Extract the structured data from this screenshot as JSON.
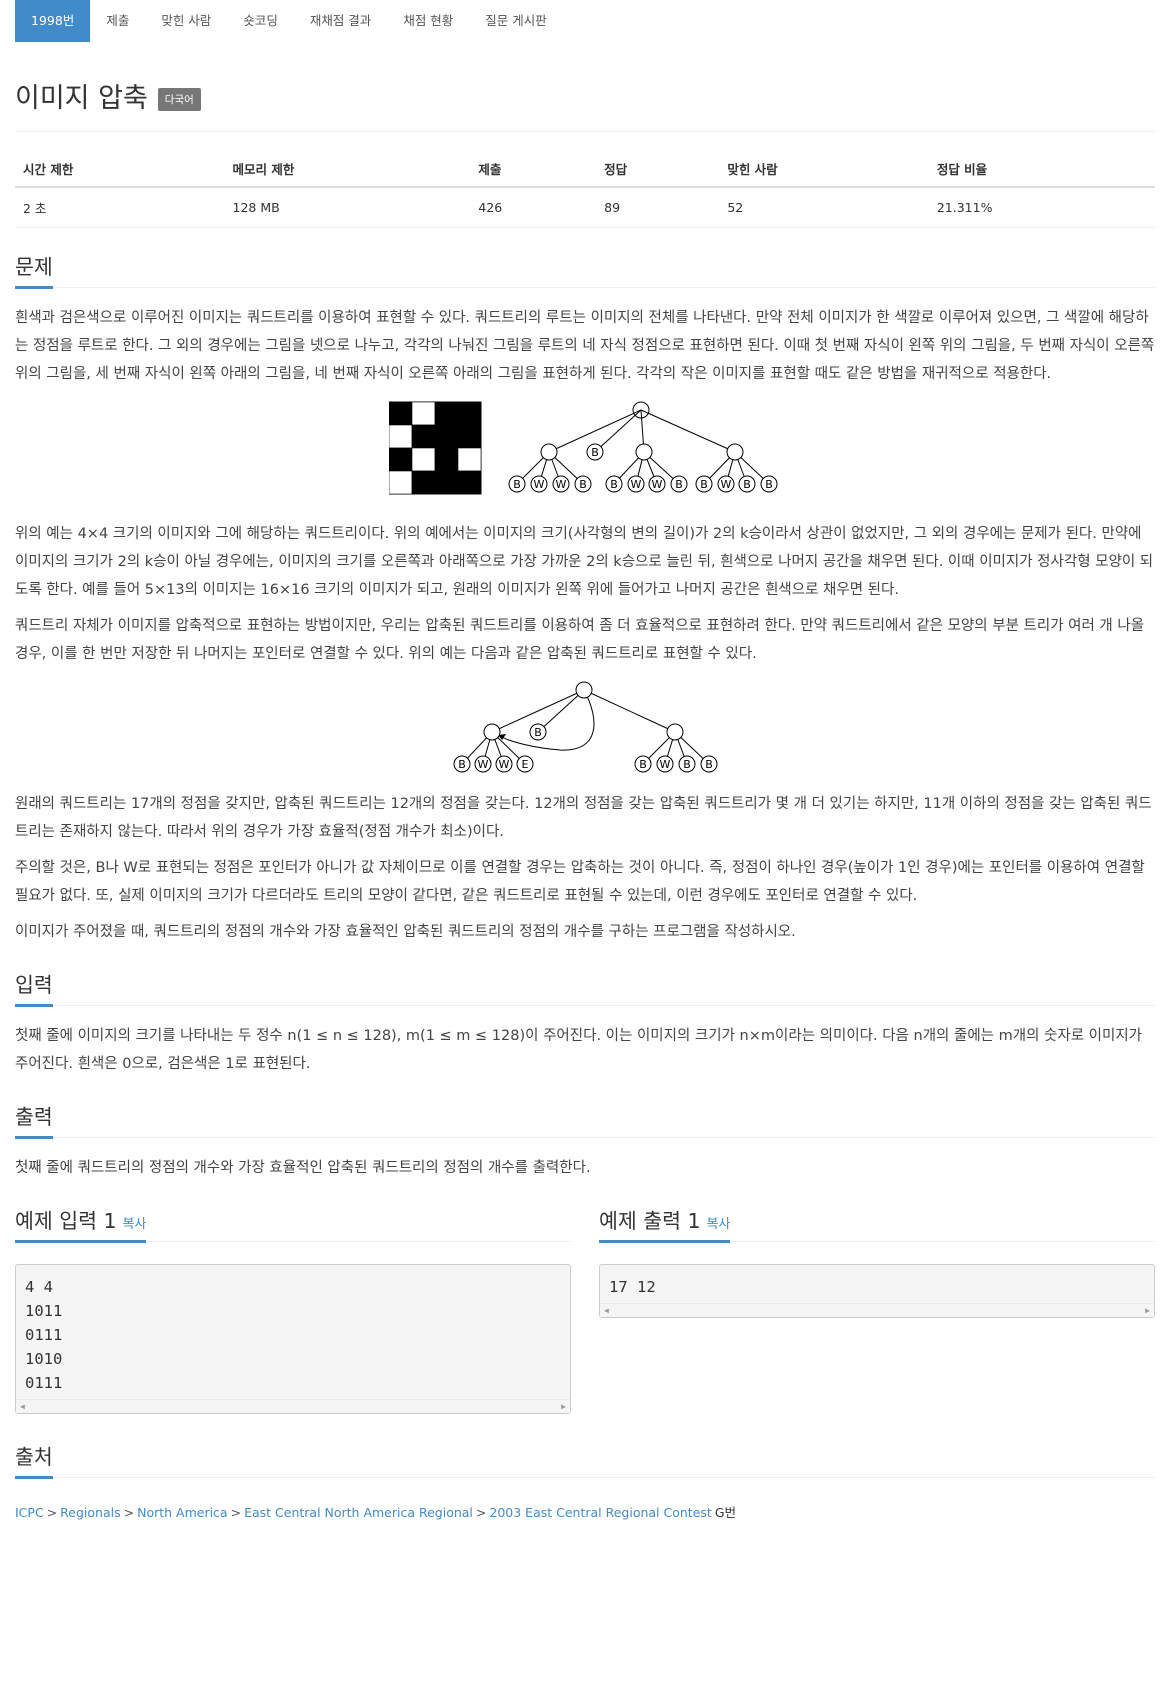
{
  "tabs": [
    {
      "label": "1998번",
      "active": true
    },
    {
      "label": "제출",
      "active": false
    },
    {
      "label": "맞힌 사람",
      "active": false
    },
    {
      "label": "숏코딩",
      "active": false
    },
    {
      "label": "재채점 결과",
      "active": false
    },
    {
      "label": "채점 현황",
      "active": false
    },
    {
      "label": "질문 게시판",
      "active": false
    }
  ],
  "problem": {
    "title": "이미지 압축",
    "badge": "다국어"
  },
  "info": {
    "headers": [
      "시간 제한",
      "메모리 제한",
      "제출",
      "정답",
      "맞힌 사람",
      "정답 비율"
    ],
    "values": [
      "2 초",
      "128 MB",
      "426",
      "89",
      "52",
      "21.311%"
    ]
  },
  "sections": {
    "problem": {
      "heading": "문제",
      "p1": "흰색과 검은색으로 이루어진 이미지는 쿼드트리를 이용하여 표현할 수 있다. 쿼드트리의 루트는 이미지의 전체를 나타낸다. 만약 전체 이미지가 한 색깔로 이루어져 있으면, 그 색깔에 해당하는 정점을 루트로 한다. 그 외의 경우에는 그림을 넷으로 나누고, 각각의 나눠진 그림을 루트의 네 자식 정점으로 표현하면 된다. 이때 첫 번째 자식이 왼쪽 위의 그림을, 두 번째 자식이 오른쪽 위의 그림을, 세 번째 자식이 왼쪽 아래의 그림을, 네 번째 자식이 오른쪽 아래의 그림을 표현하게 된다. 각각의 작은 이미지를 표현할 때도 같은 방법을 재귀적으로 적용한다.",
      "p2": "위의 예는 4×4 크기의 이미지와 그에 해당하는 쿼드트리이다. 위의 예에서는 이미지의 크기(사각형의 변의 길이)가 2의 k승이라서 상관이 없었지만, 그 외의 경우에는 문제가 된다. 만약에 이미지의 크기가 2의 k승이 아닐 경우에는, 이미지의 크기를 오른쪽과 아래쪽으로 가장 가까운 2의 k승으로 늘린 뒤, 흰색으로 나머지 공간을 채우면 된다. 이때 이미지가 정사각형 모양이 되도록 한다. 예를 들어 5×13의 이미지는 16×16 크기의 이미지가 되고, 원래의 이미지가 왼쪽 위에 들어가고 나머지 공간은 흰색으로 채우면 된다.",
      "p3": "쿼드트리 자체가 이미지를 압축적으로 표현하는 방법이지만, 우리는 압축된 쿼드트리를 이용하여 좀 더 효율적으로 표현하려 한다. 만약 쿼드트리에서 같은 모양의 부분 트리가 여러 개 나올 경우, 이를 한 번만 저장한 뒤 나머지는 포인터로 연결할 수 있다. 위의 예는 다음과 같은 압축된 쿼드트리로 표현할 수 있다.",
      "p4": "원래의 쿼드트리는 17개의 정점을 갖지만, 압축된 쿼드트리는 12개의 정점을 갖는다. 12개의 정점을 갖는 압축된 쿼드트리가 몇 개 더 있기는 하지만, 11개 이하의 정점을 갖는 압축된 쿼드트리는 존재하지 않는다. 따라서 위의 경우가 가장 효율적(정점 개수가 최소)이다.",
      "p5": "주의할 것은, B나 W로 표현되는 정점은 포인터가 아니가 값 자체이므로 이를 연결할 경우는 압축하는 것이 아니다. 즉, 정점이 하나인 경우(높이가 1인 경우)에는 포인터를 이용하여 연결할 필요가 없다. 또, 실제 이미지의 크기가 다르더라도 트리의 모양이 같다면, 같은 쿼드트리로 표현될 수 있는데, 이런 경우에도 포인터로 연결할 수 있다.",
      "p6": "이미지가 주어졌을 때, 쿼드트리의 정점의 개수와 가장 효율적인 압축된 쿼드트리의 정점의 개수를 구하는 프로그램을 작성하시오."
    },
    "input": {
      "heading": "입력",
      "p1": "첫째 줄에 이미지의 크기를 나타내는 두 정수 n(1 ≤ n ≤ 128), m(1 ≤ m ≤ 128)이 주어진다. 이는 이미지의 크기가 n×m이라는 의미이다. 다음 n개의 줄에는 m개의 숫자로 이미지가 주어진다. 흰색은 0으로, 검은색은 1로 표현된다."
    },
    "output": {
      "heading": "출력",
      "p1": "첫째 줄에 쿼드트리의 정점의 개수와 가장 효율적인 압축된 쿼드트리의 정점의 개수를 출력한다."
    },
    "sample_input": {
      "heading": "예제 입력 1",
      "copy": "복사",
      "body": "4 4\n1011\n0111\n1010\n0111"
    },
    "sample_output": {
      "heading": "예제 출력 1",
      "copy": "복사",
      "body": "17 12"
    },
    "source": {
      "heading": "출처",
      "links": [
        "ICPC",
        "Regionals",
        "North America",
        "East Central North America Regional",
        "2003 East Central Regional Contest"
      ],
      "separator": ">",
      "suffix": "G번"
    }
  },
  "figure1": {
    "grid": [
      [
        1,
        0,
        1,
        1
      ],
      [
        0,
        1,
        1,
        1
      ],
      [
        1,
        0,
        1,
        0
      ],
      [
        0,
        1,
        1,
        1
      ]
    ],
    "leaf_labels": [
      "B",
      "W",
      "W",
      "B",
      "B",
      "W",
      "W",
      "B",
      "B",
      "W",
      "B",
      "B"
    ],
    "single_leaf": "B"
  },
  "figure2": {
    "left_leaves": [
      "B",
      "W",
      "W",
      "E"
    ],
    "middle_leaf": "B",
    "right_leaves": [
      "B",
      "W",
      "B",
      "B"
    ]
  }
}
